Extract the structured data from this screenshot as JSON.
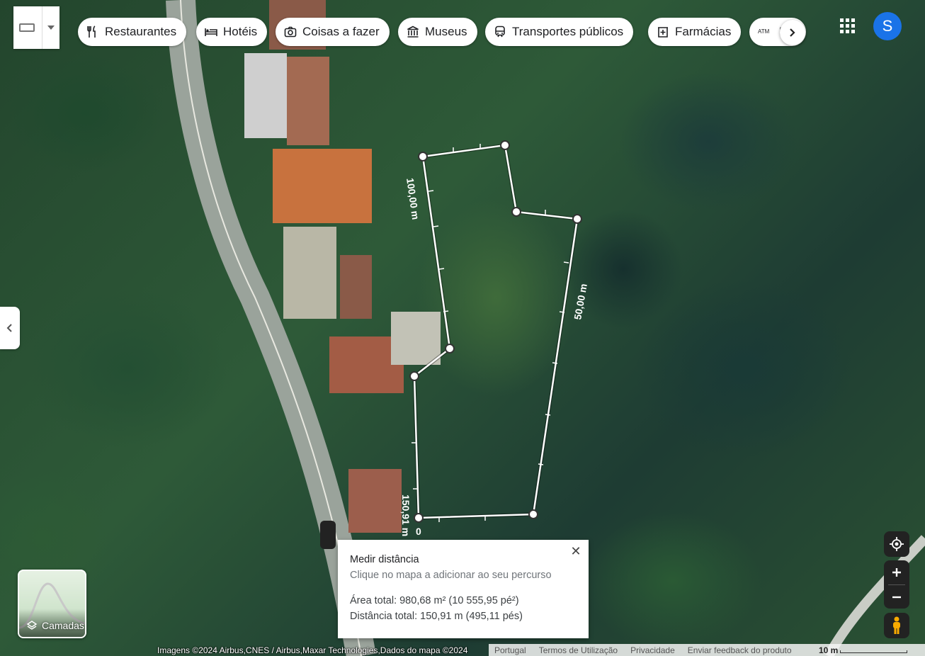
{
  "categories": [
    {
      "label": "Restaurantes",
      "icon": "fork-knife-icon"
    },
    {
      "label": "Hotéis",
      "icon": "bed-icon"
    },
    {
      "label": "Coisas a fazer",
      "icon": "camera-icon"
    },
    {
      "label": "Museus",
      "icon": "museum-icon"
    },
    {
      "label": "Transportes públicos",
      "icon": "train-icon"
    },
    {
      "label": "Farmácias",
      "icon": "pharmacy-icon"
    },
    {
      "label": "M",
      "icon": "atm-icon"
    }
  ],
  "account": {
    "initial": "S"
  },
  "measure": {
    "labels": [
      "100,00 m",
      "50,00 m",
      "150,91 m",
      "0"
    ],
    "panel": {
      "title": "Medir distância",
      "hint": "Clique no mapa a adicionar ao seu percurso",
      "area": "Área total: 980,68 m² (10 555,95 pé²)",
      "distance": "Distância total: 150,91 m (495,11 pés)"
    }
  },
  "layers": {
    "label": "Camadas"
  },
  "footer": {
    "attribution": "Imagens ©2024 Airbus,CNES / Airbus,Maxar Technologies,Dados do mapa ©2024",
    "country": "Portugal",
    "terms": "Termos de Utilização",
    "privacy": "Privacidade",
    "feedback": "Enviar feedback do produto",
    "scale": "10 m"
  },
  "colors": {
    "accent": "#1a73e8",
    "measure_line": "#ffffff"
  }
}
